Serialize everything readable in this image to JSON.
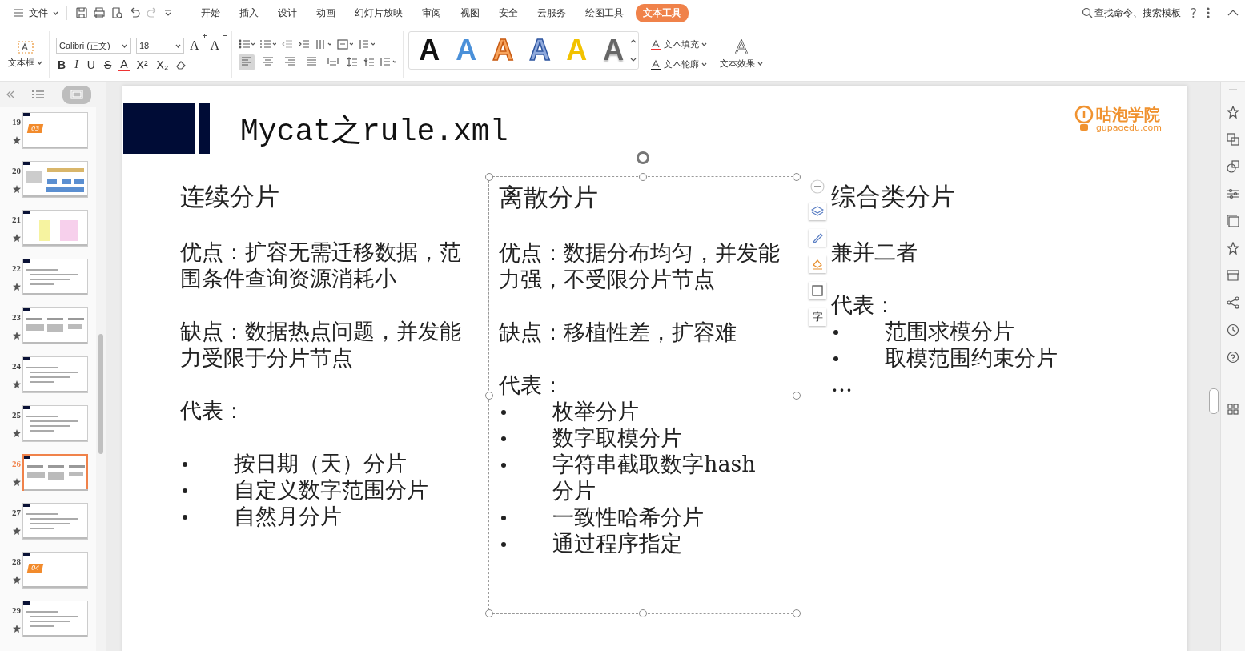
{
  "menu_bar": {
    "file_label": "文件",
    "tabs": [
      {
        "label": "开始",
        "selected": false
      },
      {
        "label": "插入",
        "selected": false
      },
      {
        "label": "设计",
        "selected": false
      },
      {
        "label": "动画",
        "selected": false
      },
      {
        "label": "幻灯片放映",
        "selected": false
      },
      {
        "label": "审阅",
        "selected": false
      },
      {
        "label": "视图",
        "selected": false
      },
      {
        "label": "安全",
        "selected": false
      },
      {
        "label": "云服务",
        "selected": false
      },
      {
        "label": "绘图工具",
        "selected": false
      },
      {
        "label": "文本工具",
        "selected": true
      }
    ],
    "search": "查找命令、搜索模板",
    "help": "?"
  },
  "ribbon": {
    "text_box_label": "文本框",
    "font_name": "Calibri (正文)",
    "font_size": "18",
    "size_buttons": [
      {
        "label": "A",
        "kind": "grow"
      },
      {
        "label": "A",
        "kind": "shrink"
      }
    ],
    "format_buttons": [
      {
        "label": "B",
        "kind": "bold"
      },
      {
        "label": "I",
        "kind": "italic"
      },
      {
        "label": "U",
        "kind": "underline"
      },
      {
        "label": "S",
        "kind": "strike"
      },
      {
        "label": "A",
        "kind": "color"
      },
      {
        "label": "X²",
        "kind": "sup"
      },
      {
        "label": "X₂",
        "kind": "sub"
      }
    ],
    "align_buttons": [
      {
        "kind": "left",
        "selected": true
      },
      {
        "kind": "center",
        "selected": false
      },
      {
        "kind": "right",
        "selected": false
      },
      {
        "kind": "justify",
        "selected": false
      },
      {
        "kind": "distribute",
        "selected": false
      }
    ],
    "art_styles": [
      {
        "label": "A",
        "kind": "black"
      },
      {
        "label": "A",
        "kind": "blue"
      },
      {
        "label": "A",
        "kind": "orange_outline"
      },
      {
        "label": "A",
        "kind": "blue_outline"
      },
      {
        "label": "A",
        "kind": "yellow"
      },
      {
        "label": "A",
        "kind": "gray_gradient"
      }
    ],
    "text_fill": "文本填充",
    "text_outline": "文本轮廓",
    "text_effect": "文本效果"
  },
  "thumbnails": [
    {
      "number": "19",
      "kind": "section",
      "badge": "03",
      "selected": false
    },
    {
      "number": "20",
      "kind": "diagram",
      "selected": false
    },
    {
      "number": "21",
      "kind": "boxes",
      "selected": false
    },
    {
      "number": "22",
      "kind": "text",
      "selected": false
    },
    {
      "number": "23",
      "kind": "columns",
      "selected": false
    },
    {
      "number": "24",
      "kind": "text",
      "selected": false
    },
    {
      "number": "25",
      "kind": "text",
      "selected": false
    },
    {
      "number": "26",
      "kind": "columns",
      "selected": true
    },
    {
      "number": "27",
      "kind": "text",
      "selected": false
    },
    {
      "number": "28",
      "kind": "section",
      "badge": "04",
      "selected": false
    },
    {
      "number": "29",
      "kind": "text",
      "selected": false
    }
  ],
  "slide": {
    "title": "Mycat之rule.xml",
    "logo_name": "咕泡学院",
    "logo_url": "gupaoedu.com",
    "side_tool_glyph": "字",
    "columns": [
      {
        "heading": "连续分片",
        "selected": false,
        "blocks": [
          {
            "kind": "blank"
          },
          {
            "kind": "text",
            "text": "优点：扩容无需迁移数据，范围条件查询资源消耗小"
          },
          {
            "kind": "blank"
          },
          {
            "kind": "text",
            "text": "缺点：数据热点问题，并发能力受限于分片节点"
          },
          {
            "kind": "blank"
          },
          {
            "kind": "text",
            "text": "代表："
          },
          {
            "kind": "blank"
          },
          {
            "kind": "bullet",
            "text": "按日期（天）分片"
          },
          {
            "kind": "bullet",
            "text": "自定义数字范围分片"
          },
          {
            "kind": "bullet",
            "text": "自然月分片"
          }
        ]
      },
      {
        "heading": "离散分片",
        "selected": true,
        "blocks": [
          {
            "kind": "blank"
          },
          {
            "kind": "text",
            "text": "优点：数据分布均匀，并发能力强，不受限分片节点"
          },
          {
            "kind": "blank"
          },
          {
            "kind": "text",
            "text": "缺点：移植性差，扩容难"
          },
          {
            "kind": "blank"
          },
          {
            "kind": "text",
            "text": "代表："
          },
          {
            "kind": "bullet",
            "text": "枚举分片"
          },
          {
            "kind": "bullet",
            "text": "数字取模分片"
          },
          {
            "kind": "bullet",
            "text": "字符串截取数字hash分片"
          },
          {
            "kind": "bullet",
            "text": "一致性哈希分片"
          },
          {
            "kind": "bullet",
            "text": "通过程序指定"
          }
        ]
      },
      {
        "heading": "综合类分片",
        "selected": false,
        "blocks": [
          {
            "kind": "blank"
          },
          {
            "kind": "text",
            "text": "兼并二者"
          },
          {
            "kind": "blank"
          },
          {
            "kind": "text",
            "text": "代表："
          },
          {
            "kind": "bullet",
            "text": "范围求模分片"
          },
          {
            "kind": "bullet",
            "text": "取模范围约束分片"
          },
          {
            "kind": "text",
            "text": "…"
          }
        ]
      }
    ]
  }
}
